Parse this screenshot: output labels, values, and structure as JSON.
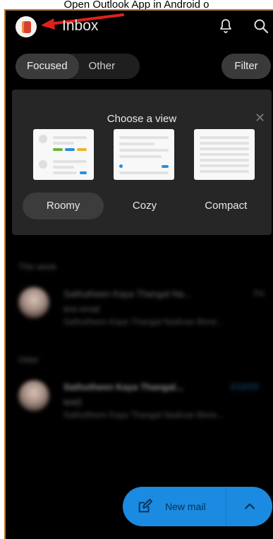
{
  "caption": "Open Outlook App in Android o",
  "header": {
    "title": "Inbox"
  },
  "tabs": [
    {
      "label": "Focused",
      "active": true
    },
    {
      "label": "Other",
      "active": false
    }
  ],
  "filter_label": "Filter",
  "view_chooser": {
    "title": "Choose a view",
    "close": "✕",
    "options": [
      {
        "label": "Roomy",
        "active": true
      },
      {
        "label": "Cozy",
        "active": false
      },
      {
        "label": "Compact",
        "active": false
      }
    ]
  },
  "mail_sections": [
    {
      "label": "This week",
      "items": [
        {
          "from": "Sathutheen Kaya Thangal Na...",
          "subject": "test email",
          "preview": "Sathutheen Kaya Thangal Nadivae Bene...",
          "date": "Fri"
        }
      ]
    },
    {
      "label": "Older",
      "items": [
        {
          "from": "Sathutheen Kaya Thangal...",
          "subject": "test2",
          "preview": "Sathutheen Kaya Thangal Nadivae Bene...",
          "date": "1/12/23"
        }
      ]
    }
  ],
  "fab": {
    "label": "New mail"
  },
  "colors": {
    "accent": "#1a8be0",
    "arrow": "#e0211b",
    "frame": "#b8772e"
  }
}
